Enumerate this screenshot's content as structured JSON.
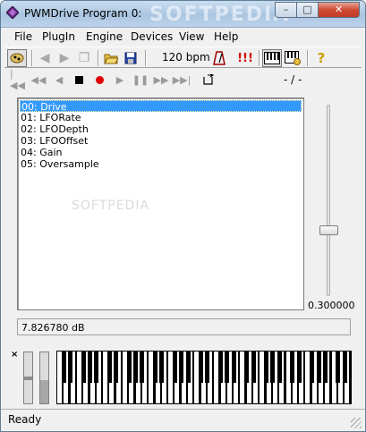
{
  "window": {
    "title": "PWMDrive Program 0:"
  },
  "watermark": {
    "text": "SOFTPEDIA",
    "small_text": "SOFTPEDIA"
  },
  "menubar": {
    "items": [
      "File",
      "PlugIn",
      "Engine",
      "Devices",
      "View",
      "Help"
    ]
  },
  "toolbar": {
    "tempo": "120 bpm",
    "buttons": [
      "plugin-icon",
      "back-arrow-icon",
      "forward-arrow-icon",
      "copy-icon",
      "open-folder-icon",
      "save-icon",
      "metronome-icon",
      "alert-icon",
      "keyboard-icon",
      "piano-settings-icon",
      "help-icon"
    ]
  },
  "transport": {
    "buttons": [
      "skip-start-icon",
      "rewind-icon",
      "step-back-icon",
      "stop-icon",
      "record-icon",
      "play-icon",
      "pause-icon",
      "step-forward-icon",
      "skip-end-icon",
      "loop-icon"
    ],
    "position": "- / -"
  },
  "parameters": {
    "items": [
      "00: Drive",
      "01: LFORate",
      "02: LFODepth",
      "03: LFOOffset",
      "04: Gain",
      "05: Oversample"
    ],
    "selected_index": 0
  },
  "slider": {
    "value": "0.300000",
    "level": 0.3
  },
  "readout": {
    "value": "7.826780 dB"
  },
  "keyboard": {
    "close_glyph": "×",
    "pitch_level": 0.5,
    "mod_level": 0.45
  },
  "statusbar": {
    "text": "Ready"
  },
  "colors": {
    "selection": "#3399ff",
    "record": "#e00000",
    "alert": "#d40000"
  }
}
